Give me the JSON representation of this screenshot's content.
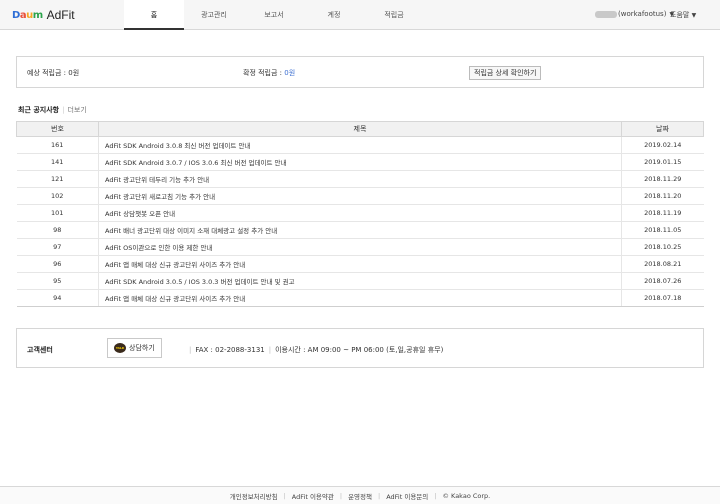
{
  "header": {
    "logo_daum": [
      "D",
      "a",
      "u",
      "m"
    ],
    "logo_adfit": "AdFit",
    "tabs": [
      "홈",
      "광고관리",
      "보고서",
      "계정",
      "적립금"
    ],
    "user": "workafootus",
    "help": "도움말"
  },
  "points": {
    "expected_label": "예상 적립금 : ",
    "expected_value": "0원",
    "confirmed_label": "확정 적립금 : ",
    "confirmed_value": "0원",
    "detail_button": "적립금 상세 확인하기"
  },
  "notice": {
    "title": "최근 공지사항",
    "more": "더보기",
    "columns": [
      "번호",
      "제목",
      "날짜"
    ],
    "rows": [
      {
        "no": "161",
        "title": "AdFit SDK Android 3.0.8 최신 버전 업데이트 안내",
        "date": "2019.02.14"
      },
      {
        "no": "141",
        "title": "AdFit SDK Android 3.0.7 / IOS 3.0.6 최신 버전 업데이트 안내",
        "date": "2019.01.15"
      },
      {
        "no": "121",
        "title": "AdFit 광고단위 테두리 기능 추가 안내",
        "date": "2018.11.29"
      },
      {
        "no": "102",
        "title": "AdFit 광고단위 새로고침 기능 추가 안내",
        "date": "2018.11.20"
      },
      {
        "no": "101",
        "title": "AdFit 상담챗봇 오픈 안내",
        "date": "2018.11.19"
      },
      {
        "no": "98",
        "title": "AdFit 배너 광고단위 대상 이미지 소재 대체광고 설정 추가 안내",
        "date": "2018.11.05"
      },
      {
        "no": "97",
        "title": "AdFit OS이관으로 인한 이용 제한 안내",
        "date": "2018.10.25"
      },
      {
        "no": "96",
        "title": "AdFit 앱 매체 대상 신규 광고단위 사이즈 추가 안내",
        "date": "2018.08.21"
      },
      {
        "no": "95",
        "title": "AdFit SDK Android 3.0.5 / IOS 3.0.3 버전 업데이트 안내 및 권고",
        "date": "2018.07.26"
      },
      {
        "no": "94",
        "title": "AdFit 앱 매체 대상 신규 광고단위 사이즈 추가 안내",
        "date": "2018.07.18"
      }
    ]
  },
  "customer_center": {
    "title": "고객센터",
    "button": "상담하기",
    "talk_icon_text": "TALK",
    "fax": "FAX : 02-2088-3131",
    "hours": "이용시간 : AM 09:00 ~ PM 06:00 (토,일,공휴일 휴무)"
  },
  "footer": {
    "links": [
      "개인정보처리방침",
      "AdFit 이용약관",
      "운영정책",
      "AdFit 이용문의"
    ],
    "copyright": "© Kakao Corp."
  }
}
